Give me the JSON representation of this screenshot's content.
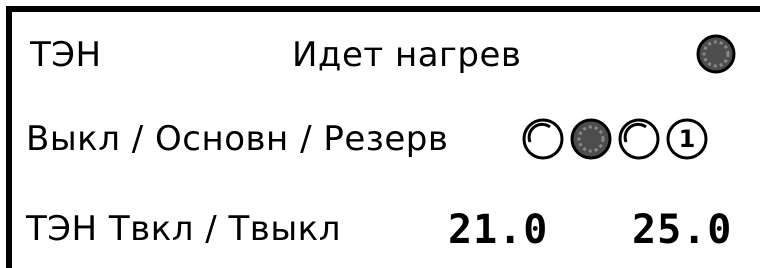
{
  "row1": {
    "label": "ТЭН",
    "status": "Идет нагрев",
    "indicator_icon": "filled-circle-indicator"
  },
  "row2": {
    "label": "Выкл / Основн / Резерв",
    "icons": [
      "empty-circle-off",
      "filled-circle-main",
      "empty-circle-reserve",
      "circled-digit-one"
    ],
    "circled_digit": "1"
  },
  "row3": {
    "label": "ТЭН Твкл / Твыкл",
    "t_on": "21.0",
    "t_off": "25.0"
  },
  "colors": {
    "foreground": "#000000",
    "background": "#ffffff",
    "indicator": "#555555"
  }
}
